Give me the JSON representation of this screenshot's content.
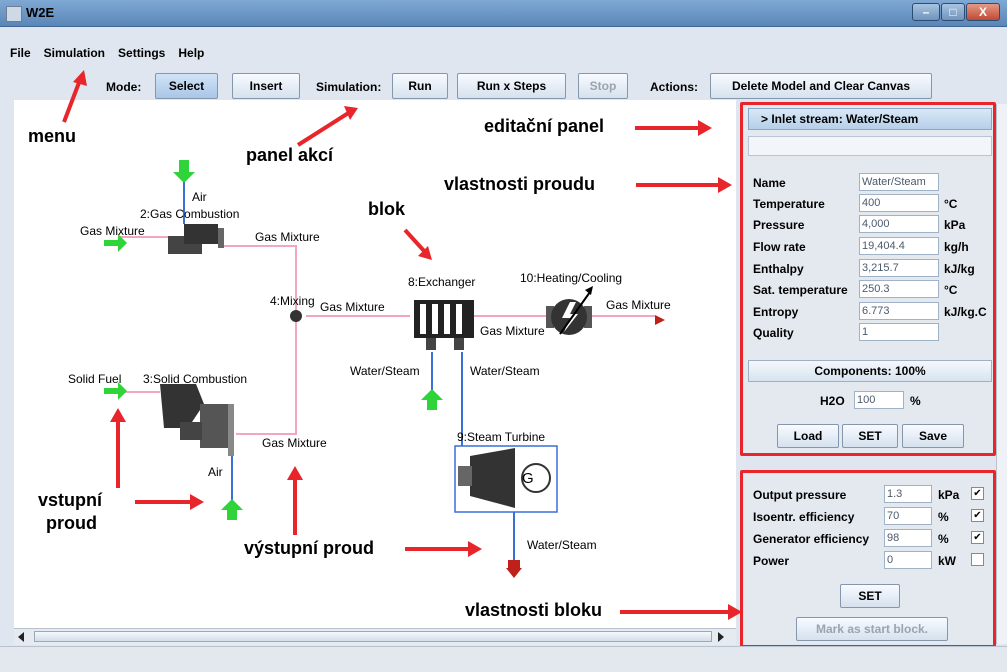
{
  "window": {
    "title": "W2E",
    "buttons": [
      "–",
      "□",
      "X"
    ]
  },
  "menu": [
    "File",
    "Simulation",
    "Settings",
    "Help"
  ],
  "toolbar": {
    "mode_label": "Mode:",
    "select": "Select",
    "insert": "Insert",
    "simulation_label": "Simulation:",
    "run": "Run",
    "run_steps": "Run x Steps",
    "stop": "Stop",
    "actions_label": "Actions:",
    "delete": "Delete Model and Clear Canvas"
  },
  "canvas": {
    "blocks": {
      "gas_combustion": "2:Gas Combustion",
      "mixing": "4:Mixing",
      "solid_combustion": "3:Solid Combustion",
      "exchanger": "8:Exchanger",
      "heating": "10:Heating/Cooling",
      "turbine": "9:Steam Turbine"
    },
    "streams": {
      "air1": "Air",
      "gas_in": "Gas Mixture",
      "gas_out1": "Gas Mixture",
      "gas_mid": "Gas Mixture",
      "gas_ex": "Gas Mixture",
      "gas_final": "Gas Mixture",
      "solid_fuel": "Solid Fuel",
      "air2": "Air",
      "gas_out2": "Gas Mixture",
      "water1": "Water/Steam",
      "water2": "Water/Steam",
      "water3": "Water/Steam",
      "gen": "G"
    }
  },
  "annotations": {
    "menu": "menu",
    "panel_akci": "panel akcí",
    "editacni": "editační panel",
    "vlastnosti_proudu": "vlastnosti proudu",
    "blok": "blok",
    "vstupni1": "vstupní",
    "vstupni2": "proud",
    "vystupni": "výstupní proud",
    "vlastnosti_bloku": "vlastnosti bloku"
  },
  "stream_panel": {
    "header": "> Inlet stream: Water/Steam",
    "rows": [
      {
        "label": "Name",
        "value": "Water/Steam",
        "unit": ""
      },
      {
        "label": "Temperature",
        "value": "400",
        "unit": "°C"
      },
      {
        "label": "Pressure",
        "value": "4,000",
        "unit": "kPa"
      },
      {
        "label": "Flow rate",
        "value": "19,404.4",
        "unit": "kg/h"
      },
      {
        "label": "Enthalpy",
        "value": "3,215.7",
        "unit": "kJ/kg"
      },
      {
        "label": "Sat. temperature",
        "value": "250.3",
        "unit": "°C"
      },
      {
        "label": "Entropy",
        "value": "6.773",
        "unit": "kJ/kg.C"
      },
      {
        "label": "Quality",
        "value": "1",
        "unit": ""
      }
    ],
    "components_header": "Components: 100%",
    "component": {
      "label": "H2O",
      "value": "100",
      "unit": "%"
    },
    "load": "Load",
    "set": "SET",
    "save": "Save"
  },
  "block_panel": {
    "rows": [
      {
        "label": "Output pressure",
        "value": "1.3",
        "unit": "kPa",
        "checked": true
      },
      {
        "label": "Isoentr. efficiency",
        "value": "70",
        "unit": "%",
        "checked": true
      },
      {
        "label": "Generator efficiency",
        "value": "98",
        "unit": "%",
        "checked": true
      },
      {
        "label": "Power",
        "value": "0",
        "unit": "kW",
        "checked": false
      }
    ],
    "set": "SET",
    "mark_start": "Mark as start block."
  },
  "colors": {
    "annotation_red": "#e8252b",
    "stream_pink": "#f4a6c0",
    "water_blue": "#3a6fd8",
    "inlet_green": "#2fd43a",
    "outlet_red": "#c0201a"
  }
}
